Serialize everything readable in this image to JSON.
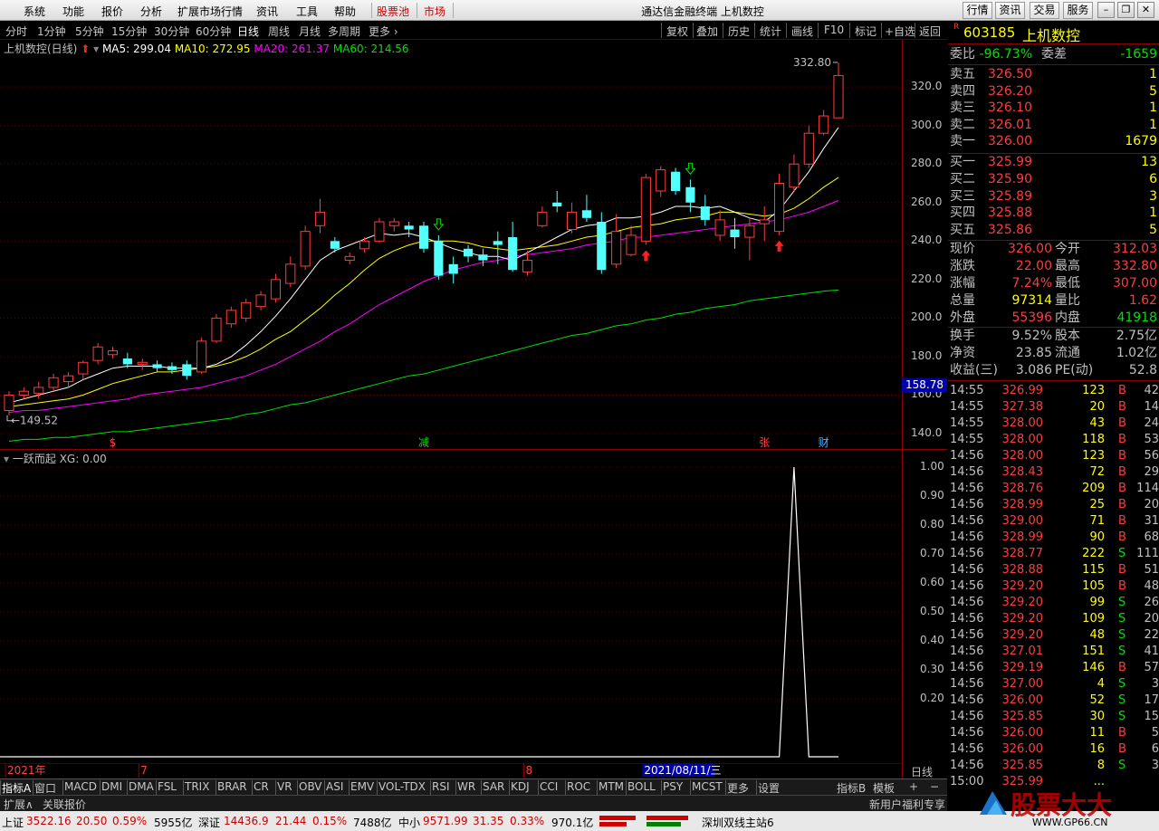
{
  "app": {
    "title": "通达信金融终端 上机数控"
  },
  "menu": {
    "items": [
      "系统",
      "功能",
      "报价",
      "分析",
      "扩展市场行情",
      "资讯",
      "工具",
      "帮助"
    ],
    "red_items": [
      "股票池",
      "市场"
    ],
    "right_buttons": [
      "行情",
      "资讯",
      "交易",
      "服务"
    ]
  },
  "periods": {
    "items": [
      "分时",
      "1分钟",
      "5分钟",
      "15分钟",
      "30分钟",
      "60分钟",
      "日线",
      "周线",
      "月线",
      "多周期",
      "更多"
    ],
    "active": "日线"
  },
  "toolbar": {
    "items": [
      "复权",
      "叠加",
      "历史",
      "统计",
      "画线",
      "F10",
      "标记",
      "+自选",
      "返回"
    ]
  },
  "chart_header": {
    "name": "上机数控(日线)",
    "ma5": "MA5: 299.04",
    "ma10": "MA10: 272.95",
    "ma20": "MA20: 261.37",
    "ma60": "MA60: 214.56"
  },
  "chart_data": {
    "type": "candlestick",
    "ylim": [
      132,
      337
    ],
    "yticks": [
      "140.0",
      "160.0",
      "180.0",
      "200.0",
      "220.0",
      "240.0",
      "260.0",
      "280.0",
      "300.0",
      "320.0"
    ],
    "high_label": "332.80",
    "low_label": "149.52",
    "cursor_price": "158.78",
    "candles": [
      [
        152,
        160,
        149.5,
        162
      ],
      [
        160,
        162,
        158,
        164
      ],
      [
        161,
        164,
        158,
        167
      ],
      [
        164,
        169,
        162,
        171
      ],
      [
        167,
        170,
        164,
        172
      ],
      [
        171,
        177,
        168,
        178
      ],
      [
        178,
        185,
        176,
        187
      ],
      [
        181,
        183,
        179,
        185
      ],
      [
        179,
        176,
        174,
        182
      ],
      [
        176,
        177,
        173,
        179
      ],
      [
        176,
        174,
        172,
        178
      ],
      [
        175,
        173,
        171,
        177
      ],
      [
        176,
        170,
        168,
        178
      ],
      [
        172,
        188,
        171,
        190
      ],
      [
        188,
        200,
        187,
        202
      ],
      [
        197,
        204,
        195,
        206
      ],
      [
        200,
        208,
        198,
        210
      ],
      [
        206,
        212,
        204,
        214
      ],
      [
        210,
        220,
        208,
        223
      ],
      [
        218,
        228,
        216,
        232
      ],
      [
        227,
        245,
        225,
        248
      ],
      [
        248,
        255,
        244,
        262
      ],
      [
        240,
        236,
        234,
        242
      ],
      [
        230,
        232,
        228,
        234
      ],
      [
        236,
        240,
        234,
        242
      ],
      [
        240,
        250,
        239,
        252
      ],
      [
        248,
        250,
        245,
        252
      ],
      [
        248,
        246,
        242,
        250
      ],
      [
        248,
        236,
        234,
        250
      ],
      [
        240,
        222,
        220,
        243
      ],
      [
        228,
        223,
        218,
        232
      ],
      [
        236,
        232,
        229,
        238
      ],
      [
        233,
        230,
        227,
        236
      ],
      [
        240,
        238,
        228,
        245
      ],
      [
        242,
        225,
        224,
        250
      ],
      [
        224,
        230,
        222,
        235
      ],
      [
        248,
        255,
        247,
        258
      ],
      [
        260,
        258,
        255,
        266
      ],
      [
        246,
        255,
        244,
        260
      ],
      [
        256,
        252,
        250,
        264
      ],
      [
        250,
        225,
        223,
        255
      ],
      [
        228,
        245,
        226,
        254
      ],
      [
        233,
        243,
        232,
        248
      ],
      [
        240,
        273,
        238,
        275
      ],
      [
        266,
        277,
        263,
        279
      ],
      [
        276,
        266,
        264,
        278
      ],
      [
        268,
        260,
        255,
        272
      ],
      [
        258,
        251,
        248,
        264
      ],
      [
        243,
        251,
        240,
        256
      ],
      [
        246,
        242,
        236,
        252
      ],
      [
        242,
        248,
        230,
        252
      ],
      [
        249,
        251,
        240,
        258
      ],
      [
        245,
        270,
        243,
        275
      ],
      [
        268,
        280,
        266,
        285
      ],
      [
        280,
        296,
        278,
        300
      ],
      [
        296,
        305,
        295,
        308
      ],
      [
        304,
        326,
        307,
        332.8
      ]
    ],
    "ma5": [
      156,
      158,
      160,
      162,
      164,
      168,
      171,
      174,
      175,
      175,
      175,
      174,
      174,
      174,
      176,
      180,
      186,
      193,
      201,
      210,
      220,
      230,
      235,
      238,
      241,
      244,
      243,
      244,
      242,
      239,
      236,
      234,
      232,
      232,
      230,
      234,
      238,
      242,
      246,
      248,
      249,
      252,
      252,
      253,
      255,
      258,
      258,
      257,
      258,
      255,
      252,
      250,
      256,
      266,
      276,
      288,
      299
    ],
    "ma10": [
      154,
      155,
      156,
      157,
      158,
      160,
      163,
      166,
      168,
      170,
      172,
      172,
      173,
      174,
      175,
      177,
      180,
      184,
      189,
      193,
      199,
      205,
      212,
      218,
      225,
      231,
      235,
      238,
      240,
      240,
      240,
      239,
      237,
      236,
      235,
      236,
      237,
      238,
      240,
      242,
      243,
      245,
      247,
      248,
      249,
      251,
      252,
      253,
      255,
      255,
      254,
      253,
      254,
      257,
      262,
      268,
      273
    ],
    "ma20": [
      151,
      152,
      152,
      153,
      154,
      155,
      156,
      157,
      158,
      160,
      161,
      162,
      163,
      164,
      166,
      168,
      170,
      173,
      176,
      180,
      184,
      188,
      193,
      197,
      202,
      207,
      211,
      215,
      219,
      222,
      225,
      227,
      229,
      230,
      232,
      233,
      234,
      235,
      236,
      238,
      239,
      240,
      242,
      242,
      243,
      244,
      245,
      246,
      247,
      248,
      249,
      250,
      251,
      253,
      255,
      258,
      261
    ],
    "ma60": [
      136,
      137,
      137,
      138,
      138,
      139,
      140,
      141,
      141,
      142,
      143,
      144,
      145,
      146,
      147,
      148,
      150,
      151,
      153,
      155,
      156,
      158,
      160,
      162,
      164,
      166,
      168,
      170,
      171,
      173,
      175,
      177,
      179,
      181,
      183,
      185,
      187,
      189,
      191,
      192,
      194,
      196,
      197,
      199,
      200,
      202,
      203,
      205,
      206,
      207,
      209,
      210,
      211,
      212,
      213,
      214,
      214.56
    ],
    "markers": {
      "up_arrows": [
        43,
        52
      ],
      "down_arrows": [
        29,
        46
      ]
    },
    "event_labels": [
      {
        "idx": 7,
        "text": "$"
      },
      {
        "idx": 28,
        "text": "减"
      },
      {
        "idx": 51,
        "text": "张"
      },
      {
        "idx": 55,
        "text": "财"
      }
    ],
    "indicator": {
      "name": "一跃而起",
      "value_label": "XG: 0.00",
      "yticks": [
        "0.20",
        "0.30",
        "0.40",
        "0.50",
        "0.60",
        "0.70",
        "0.80",
        "0.90",
        "1.00"
      ],
      "values": [
        0,
        0,
        0,
        0,
        0,
        0,
        0,
        0,
        0,
        0,
        0,
        0,
        0,
        0,
        0,
        0,
        0,
        0,
        0,
        0,
        0,
        0,
        0,
        0,
        0,
        0,
        0,
        0,
        0,
        0,
        0,
        0,
        0,
        0,
        0,
        0,
        0,
        0,
        0,
        0,
        0,
        0,
        0,
        0,
        0,
        0,
        0,
        0,
        0,
        0,
        0,
        0,
        0,
        1,
        0,
        0,
        0
      ]
    },
    "xlabels": [
      {
        "idx": 0,
        "text": "2021年"
      },
      {
        "idx": 9,
        "text": "7"
      },
      {
        "idx": 35,
        "text": "8"
      },
      {
        "idx": 43,
        "text": "2021/08/11/三",
        "hl": true
      }
    ],
    "axis_right_label": "日线"
  },
  "tabs": {
    "items": [
      "指标A",
      "窗口",
      "MACD",
      "DMI",
      "DMA",
      "FSL",
      "TRIX",
      "BRAR",
      "CR",
      "VR",
      "OBV",
      "ASI",
      "EMV",
      "VOL-TDX",
      "RSI",
      "WR",
      "SAR",
      "KDJ",
      "CCI",
      "ROC",
      "MTM",
      "BOLL",
      "PSY",
      "MCST",
      "更多",
      "设置"
    ],
    "right": [
      "指标B",
      "模板",
      "+",
      "−"
    ]
  },
  "ext": {
    "items": [
      "扩展∧",
      "关联报价"
    ],
    "right": "新用户福利专享"
  },
  "quote": {
    "code": "603185",
    "name": "上机数控",
    "weibi": {
      "label": "委比",
      "value": "-96.73%",
      "label2": "委差",
      "value2": "-1659"
    },
    "sell": [
      [
        "卖五",
        "326.50",
        "1"
      ],
      [
        "卖四",
        "326.20",
        "5"
      ],
      [
        "卖三",
        "326.10",
        "1"
      ],
      [
        "卖二",
        "326.01",
        "1"
      ],
      [
        "卖一",
        "326.00",
        "1679"
      ]
    ],
    "buy": [
      [
        "买一",
        "325.99",
        "13"
      ],
      [
        "买二",
        "325.90",
        "6"
      ],
      [
        "买三",
        "325.89",
        "3"
      ],
      [
        "买四",
        "325.88",
        "1"
      ],
      [
        "买五",
        "325.86",
        "5"
      ]
    ],
    "stats": [
      [
        "现价",
        "326.00",
        "今开",
        "312.03"
      ],
      [
        "涨跌",
        "22.00",
        "最高",
        "332.80"
      ],
      [
        "涨幅",
        "7.24%",
        "最低",
        "307.00"
      ],
      [
        "总量",
        "97314",
        "量比",
        "1.62"
      ],
      [
        "外盘",
        "55396",
        "内盘",
        "41918"
      ]
    ],
    "stats2": [
      [
        "换手",
        "9.52%",
        "股本",
        "2.75亿"
      ],
      [
        "净资",
        "23.85",
        "流通",
        "1.02亿"
      ],
      [
        "收益(三)",
        "3.086",
        "PE(动)",
        "52.8"
      ]
    ]
  },
  "ticks": [
    [
      "14:55",
      "326.99",
      "123",
      "B",
      "42"
    ],
    [
      "14:55",
      "327.38",
      "20",
      "B",
      "14"
    ],
    [
      "14:55",
      "328.00",
      "43",
      "B",
      "24"
    ],
    [
      "14:55",
      "328.00",
      "118",
      "B",
      "53"
    ],
    [
      "14:56",
      "328.00",
      "123",
      "B",
      "56"
    ],
    [
      "14:56",
      "328.43",
      "72",
      "B",
      "29"
    ],
    [
      "14:56",
      "328.76",
      "209",
      "B",
      "114"
    ],
    [
      "14:56",
      "328.99",
      "25",
      "B",
      "20"
    ],
    [
      "14:56",
      "329.00",
      "71",
      "B",
      "31"
    ],
    [
      "14:56",
      "328.99",
      "90",
      "B",
      "68"
    ],
    [
      "14:56",
      "328.77",
      "222",
      "S",
      "111"
    ],
    [
      "14:56",
      "328.88",
      "115",
      "B",
      "51"
    ],
    [
      "14:56",
      "329.20",
      "105",
      "B",
      "48"
    ],
    [
      "14:56",
      "329.20",
      "99",
      "S",
      "26"
    ],
    [
      "14:56",
      "329.20",
      "109",
      "S",
      "20"
    ],
    [
      "14:56",
      "329.20",
      "48",
      "S",
      "22"
    ],
    [
      "14:56",
      "327.01",
      "151",
      "S",
      "41"
    ],
    [
      "14:56",
      "329.19",
      "146",
      "B",
      "57"
    ],
    [
      "14:56",
      "327.00",
      "4",
      "S",
      "3"
    ],
    [
      "14:56",
      "326.00",
      "52",
      "S",
      "17"
    ],
    [
      "14:56",
      "325.85",
      "30",
      "S",
      "15"
    ],
    [
      "14:56",
      "326.00",
      "11",
      "B",
      "5"
    ],
    [
      "14:56",
      "326.00",
      "16",
      "B",
      "6"
    ],
    [
      "14:56",
      "325.85",
      "8",
      "S",
      "3"
    ],
    [
      "15:00",
      "325.99",
      "...",
      "",
      ""
    ]
  ],
  "status": {
    "sh_label": "上证",
    "sh_value": "3522.16",
    "sh_chg": "20.50",
    "sh_pct": "0.59%",
    "sh_amt": "5955亿",
    "sz_label": "深证",
    "sz_value": "14436.9",
    "sz_chg": "21.44",
    "sz_pct": "0.15%",
    "sz_amt": "7488亿",
    "zx_label": "中小",
    "zx_value": "9571.99",
    "zx_chg": "31.35",
    "zx_pct": "0.33%",
    "zx_amt": "970.1亿",
    "site": "深圳双线主站6"
  },
  "watermark": {
    "text": "股票大大",
    "url": "WWW.GP66.CN"
  },
  "colors": {
    "up": "#ff3c3c",
    "down": "#54ffff",
    "ma5": "#ffffff",
    "ma10": "#ffff00",
    "ma20": "#ff00ff",
    "ma60": "#00e000"
  }
}
